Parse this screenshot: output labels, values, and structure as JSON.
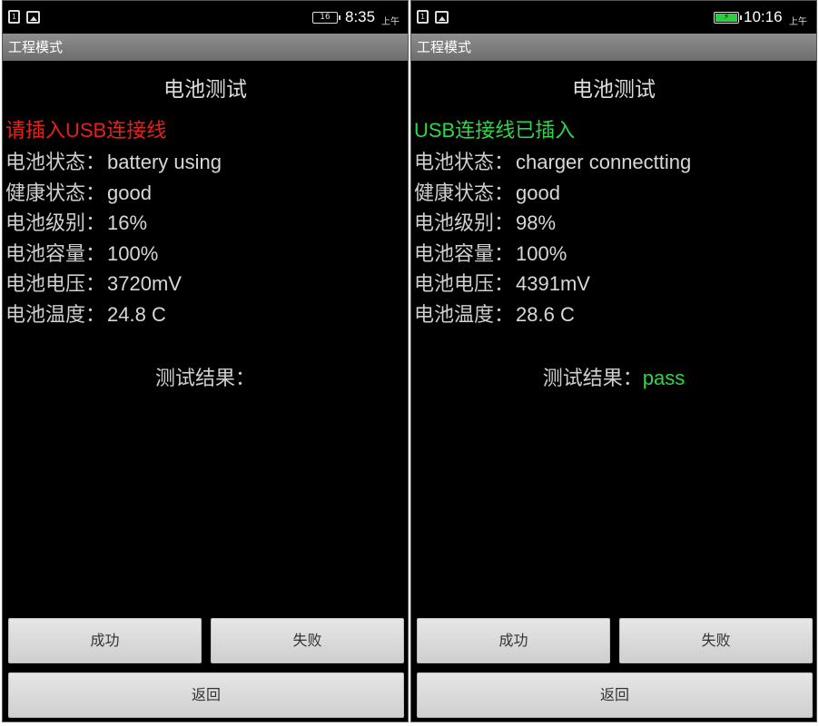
{
  "left": {
    "status_bar": {
      "sd_icon": "sd-card-icon",
      "image_icon": "image-icon",
      "battery_label": "16",
      "time": "8:35",
      "ampm": "上午"
    },
    "app_bar_title": "工程模式",
    "screen_title": "电池测试",
    "usb_status": "请插入USB连接线",
    "usb_status_color": "#e8201c",
    "rows": [
      {
        "label": "电池状态：",
        "value": "battery using"
      },
      {
        "label": "健康状态：",
        "value": "good"
      },
      {
        "label": "电池级别：",
        "value": "16%"
      },
      {
        "label": "电池容量：",
        "value": "100%"
      },
      {
        "label": "电池电压：",
        "value": "3720mV"
      },
      {
        "label": "电池温度：",
        "value": "24.8 C"
      }
    ],
    "result_label": "测试结果：",
    "result_value": "",
    "buttons": {
      "success": "成功",
      "fail": "失败",
      "back": "返回"
    }
  },
  "right": {
    "status_bar": {
      "sd_icon": "sd-card-icon",
      "image_icon": "image-icon",
      "battery_icon": "battery-charging-icon",
      "time": "10:16",
      "ampm": "上午"
    },
    "app_bar_title": "工程模式",
    "screen_title": "电池测试",
    "usb_status": "USB连接线已插入",
    "usb_status_color": "#2ed64a",
    "rows": [
      {
        "label": "电池状态：",
        "value": "charger connectting"
      },
      {
        "label": "健康状态：",
        "value": "good"
      },
      {
        "label": "电池级别：",
        "value": "98%"
      },
      {
        "label": "电池容量：",
        "value": "100%"
      },
      {
        "label": "电池电压：",
        "value": "4391mV"
      },
      {
        "label": "电池温度：",
        "value": "28.6 C"
      }
    ],
    "result_label": "测试结果：",
    "result_value": "pass",
    "buttons": {
      "success": "成功",
      "fail": "失败",
      "back": "返回"
    }
  }
}
